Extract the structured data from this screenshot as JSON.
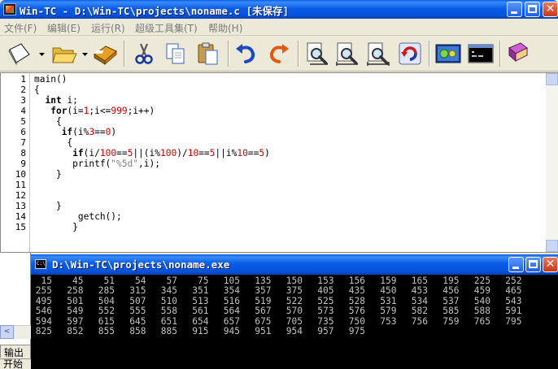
{
  "window": {
    "title": "Win-TC - D:\\Win-TC\\projects\\noname.c [未保存]",
    "close_glyph": "✕"
  },
  "menu": {
    "items": [
      {
        "label": "文件(F)"
      },
      {
        "label": "编辑(E)"
      },
      {
        "label": "运行(R)"
      },
      {
        "label": "超级工具集(T)"
      },
      {
        "label": "帮助(H)"
      }
    ]
  },
  "toolbar": {
    "icons": [
      "new-file-icon",
      "open-folder-icon",
      "save-disk-icon",
      "cut-icon",
      "copy-icon",
      "paste-icon",
      "undo-icon",
      "redo-icon",
      "find-icon",
      "find-next-icon",
      "replace-icon",
      "refresh-icon",
      "compile-run-icon",
      "console-icon",
      "help-book-icon"
    ]
  },
  "editor": {
    "line_numbers": [
      "1",
      "2",
      "3",
      "4",
      "5",
      "6",
      "7",
      "8",
      "9",
      "10",
      "11",
      "12",
      "13",
      "14",
      "15"
    ],
    "lines": [
      [
        {
          "t": "main()",
          "c": ""
        }
      ],
      [
        {
          "t": "{",
          "c": ""
        }
      ],
      [
        {
          "t": "  ",
          "c": ""
        },
        {
          "t": "int",
          "c": "kw"
        },
        {
          "t": " i;",
          "c": ""
        }
      ],
      [
        {
          "t": "   ",
          "c": ""
        },
        {
          "t": "for",
          "c": "kw"
        },
        {
          "t": "(i=",
          "c": ""
        },
        {
          "t": "1",
          "c": "num"
        },
        {
          "t": ";i<=",
          "c": ""
        },
        {
          "t": "999",
          "c": "num"
        },
        {
          "t": ";i++)",
          "c": ""
        }
      ],
      [
        {
          "t": "    {",
          "c": ""
        }
      ],
      [
        {
          "t": "     ",
          "c": ""
        },
        {
          "t": "if",
          "c": "kw"
        },
        {
          "t": "(i%",
          "c": ""
        },
        {
          "t": "3",
          "c": "num"
        },
        {
          "t": "==",
          "c": ""
        },
        {
          "t": "0",
          "c": "num"
        },
        {
          "t": ")",
          "c": ""
        }
      ],
      [
        {
          "t": "      {",
          "c": ""
        }
      ],
      [
        {
          "t": "       ",
          "c": ""
        },
        {
          "t": "if",
          "c": "kw"
        },
        {
          "t": "(i/",
          "c": ""
        },
        {
          "t": "100",
          "c": "num"
        },
        {
          "t": "==",
          "c": ""
        },
        {
          "t": "5",
          "c": "num"
        },
        {
          "t": "||(i%",
          "c": ""
        },
        {
          "t": "100",
          "c": "num"
        },
        {
          "t": ")/",
          "c": ""
        },
        {
          "t": "10",
          "c": "num"
        },
        {
          "t": "==",
          "c": ""
        },
        {
          "t": "5",
          "c": "num"
        },
        {
          "t": "||i%",
          "c": ""
        },
        {
          "t": "10",
          "c": "num"
        },
        {
          "t": "==",
          "c": ""
        },
        {
          "t": "5",
          "c": "num"
        },
        {
          "t": ")",
          "c": ""
        }
      ],
      [
        {
          "t": "       printf(",
          "c": ""
        },
        {
          "t": "\"%5d\"",
          "c": "str"
        },
        {
          "t": ",i);",
          "c": ""
        }
      ],
      [
        {
          "t": "    }",
          "c": ""
        }
      ],
      [
        {
          "t": "",
          "c": ""
        }
      ],
      [
        {
          "t": "",
          "c": ""
        }
      ],
      [
        {
          "t": "    }",
          "c": ""
        }
      ],
      [
        {
          "t": "        getch();",
          "c": ""
        }
      ],
      [
        {
          "t": "       }",
          "c": ""
        }
      ]
    ]
  },
  "left_panel": {
    "scroll_left_glyph": "<",
    "tab_output": "输出",
    "tab_start": "开始"
  },
  "console": {
    "title": "D:\\Win-TC\\projects\\noname.exe",
    "icon_text": "C:\\",
    "close_glyph": "✕",
    "output_rows": [
      [
        "15",
        "45",
        "51",
        "54",
        "57",
        "75",
        "105",
        "135",
        "150",
        "153",
        "156",
        "159",
        "165",
        "195",
        "225",
        "252"
      ],
      [
        "255",
        "258",
        "285",
        "315",
        "345",
        "351",
        "354",
        "357",
        "375",
        "405",
        "435",
        "450",
        "453",
        "456",
        "459",
        "465"
      ],
      [
        "495",
        "501",
        "504",
        "507",
        "510",
        "513",
        "516",
        "519",
        "522",
        "525",
        "528",
        "531",
        "534",
        "537",
        "540",
        "543"
      ],
      [
        "546",
        "549",
        "552",
        "555",
        "558",
        "561",
        "564",
        "567",
        "570",
        "573",
        "576",
        "579",
        "582",
        "585",
        "588",
        "591"
      ],
      [
        "594",
        "597",
        "615",
        "645",
        "651",
        "654",
        "657",
        "675",
        "705",
        "735",
        "750",
        "753",
        "756",
        "759",
        "765",
        "795"
      ],
      [
        "825",
        "852",
        "855",
        "858",
        "885",
        "915",
        "945",
        "951",
        "954",
        "957",
        "975"
      ]
    ]
  }
}
